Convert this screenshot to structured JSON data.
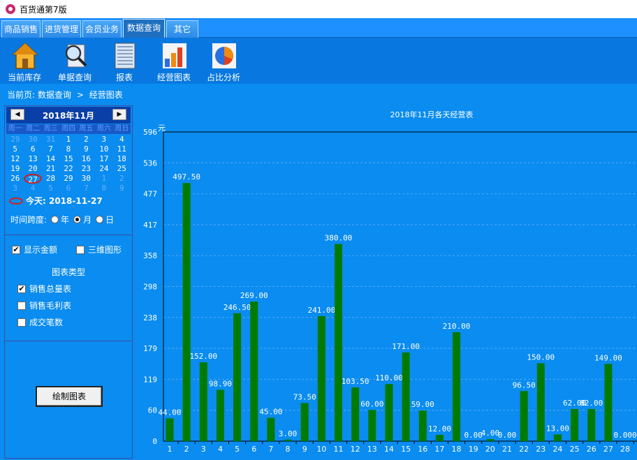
{
  "window": {
    "title": "百货通第7版"
  },
  "tabs": [
    {
      "label": "商品销售",
      "active": false
    },
    {
      "label": "进货管理",
      "active": false
    },
    {
      "label": "会员业务",
      "active": false
    },
    {
      "label": "数据查询",
      "active": true
    },
    {
      "label": "其它",
      "active": false
    }
  ],
  "toolbar": {
    "items": [
      {
        "label": "当前库存",
        "icon": "house-icon"
      },
      {
        "label": "单据查询",
        "icon": "magnifier-document-icon"
      },
      {
        "label": "报表",
        "icon": "report-icon"
      },
      {
        "label": "经营图表",
        "icon": "bar-chart-icon"
      },
      {
        "label": "占比分析",
        "icon": "pie-chart-icon"
      }
    ]
  },
  "breadcrumb": {
    "prefix": "当前页:",
    "section": "数据查询",
    "separator": ">",
    "page": "经营图表"
  },
  "calendar": {
    "month_label": "2018年11月",
    "prev": "◀",
    "next": "▶",
    "weekdays": [
      "周一",
      "周二",
      "周三",
      "周四",
      "周五",
      "周六",
      "周日"
    ],
    "days": [
      [
        "29",
        "30",
        "31",
        "1",
        "2",
        "3",
        "4"
      ],
      [
        "5",
        "6",
        "7",
        "8",
        "9",
        "10",
        "11"
      ],
      [
        "12",
        "13",
        "14",
        "15",
        "16",
        "17",
        "18"
      ],
      [
        "19",
        "20",
        "21",
        "22",
        "23",
        "24",
        "25"
      ],
      [
        "26",
        "27",
        "28",
        "29",
        "30",
        "1",
        "2"
      ],
      [
        "3",
        "4",
        "5",
        "6",
        "7",
        "8",
        "9"
      ]
    ],
    "today_label": "今天: 2018-11-27"
  },
  "time_span": {
    "label": "时间跨度:",
    "options": [
      {
        "label": "年",
        "selected": false
      },
      {
        "label": "月",
        "selected": true
      },
      {
        "label": "日",
        "selected": false
      }
    ]
  },
  "options": {
    "show_amount": {
      "label": "显示金额",
      "checked": true
    },
    "three_d": {
      "label": "三维图形",
      "checked": false
    }
  },
  "chart_types": {
    "title": "图表类型",
    "items": [
      {
        "label": "销售总量表",
        "checked": true
      },
      {
        "label": "销售毛利表",
        "checked": false
      },
      {
        "label": "成交笔数",
        "checked": false
      }
    ]
  },
  "draw_button": {
    "label": "绘制图表"
  },
  "colors": {
    "bar": "#007a00",
    "background": "#0a8cf0",
    "gridline": "#5aa8f0"
  },
  "chart_data": {
    "type": "bar",
    "title": "2018年11月各天经营表",
    "ylabel": "元",
    "xlabel": "",
    "ylim": [
      0,
      596
    ],
    "yticks": [
      "0",
      "60",
      "119",
      "179",
      "238",
      "298",
      "358",
      "417",
      "477",
      "536",
      "596"
    ],
    "categories": [
      "1",
      "2",
      "3",
      "4",
      "5",
      "6",
      "7",
      "8",
      "9",
      "10",
      "11",
      "12",
      "13",
      "14",
      "15",
      "16",
      "17",
      "18",
      "19",
      "20",
      "21",
      "22",
      "23",
      "24",
      "25",
      "26",
      "27",
      "28"
    ],
    "values": [
      44.0,
      497.5,
      152.0,
      98.9,
      246.5,
      269.0,
      45.0,
      3.0,
      73.5,
      241.0,
      380.0,
      103.5,
      60.0,
      110.0,
      171.0,
      59.0,
      12.0,
      210.0,
      0.0,
      4.0,
      0.0,
      96.5,
      150.0,
      13.0,
      62.0,
      62.0,
      149.0,
      0.0
    ],
    "labels": [
      "44.00",
      "497.50",
      "152.00",
      "98.90",
      "246.50",
      "269.00",
      "45.00",
      "3.00",
      "73.50",
      "241.00",
      "380.00",
      "103.50",
      "60.00",
      "110.00",
      "171.00",
      "59.00",
      "12.00",
      "210.00",
      "0.00",
      "4.00",
      "0.00",
      "96.50",
      "150.00",
      "13.00",
      "62.00",
      "82.00",
      "149.00",
      "0.000"
    ],
    "grid": true
  }
}
